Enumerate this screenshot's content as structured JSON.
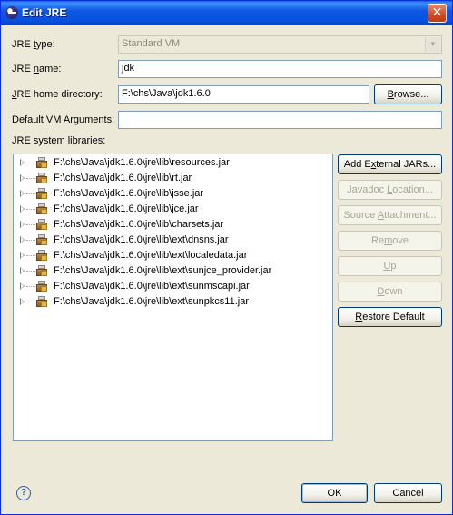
{
  "window": {
    "title": "Edit JRE",
    "close_glyph": "✕"
  },
  "form": {
    "jre_type_label": "JRE type:",
    "jre_type_value": "Standard VM",
    "jre_name_label": "JRE name:",
    "jre_name_value": "jdk",
    "home_dir_label": "JRE home directory:",
    "home_dir_value": "F:\\chs\\Java\\jdk1.6.0",
    "browse_label": "Browse...",
    "vm_args_label": "Default VM Arguments:",
    "vm_args_value": "",
    "libraries_label": "JRE system libraries:"
  },
  "libraries": [
    {
      "path": "F:\\chs\\Java\\jdk1.6.0\\jre\\lib\\resources.jar"
    },
    {
      "path": "F:\\chs\\Java\\jdk1.6.0\\jre\\lib\\rt.jar"
    },
    {
      "path": "F:\\chs\\Java\\jdk1.6.0\\jre\\lib\\jsse.jar"
    },
    {
      "path": "F:\\chs\\Java\\jdk1.6.0\\jre\\lib\\jce.jar"
    },
    {
      "path": "F:\\chs\\Java\\jdk1.6.0\\jre\\lib\\charsets.jar"
    },
    {
      "path": "F:\\chs\\Java\\jdk1.6.0\\jre\\lib\\ext\\dnsns.jar"
    },
    {
      "path": "F:\\chs\\Java\\jdk1.6.0\\jre\\lib\\ext\\localedata.jar"
    },
    {
      "path": "F:\\chs\\Java\\jdk1.6.0\\jre\\lib\\ext\\sunjce_provider.jar"
    },
    {
      "path": "F:\\chs\\Java\\jdk1.6.0\\jre\\lib\\ext\\sunmscapi.jar"
    },
    {
      "path": "F:\\chs\\Java\\jdk1.6.0\\jre\\lib\\ext\\sunpkcs11.jar"
    }
  ],
  "side_buttons": {
    "add_external_jars": "Add External JARs...",
    "javadoc_location": "Javadoc Location...",
    "source_attachment": "Source Attachment...",
    "remove": "Remove",
    "up": "Up",
    "down": "Down",
    "restore_default": "Restore Default"
  },
  "footer": {
    "help_glyph": "?",
    "ok_label": "OK",
    "cancel_label": "Cancel"
  },
  "icons": {
    "title": "eclipse-icon",
    "help": "help-icon",
    "library": "jar-library-icon",
    "expander": "tree-expand-icon",
    "combo": "chevron-down-icon"
  },
  "colors": {
    "titlebar": "#0a5fef",
    "background": "#ece9d8",
    "field_border": "#7f9db9",
    "button_border": "#003c74"
  }
}
